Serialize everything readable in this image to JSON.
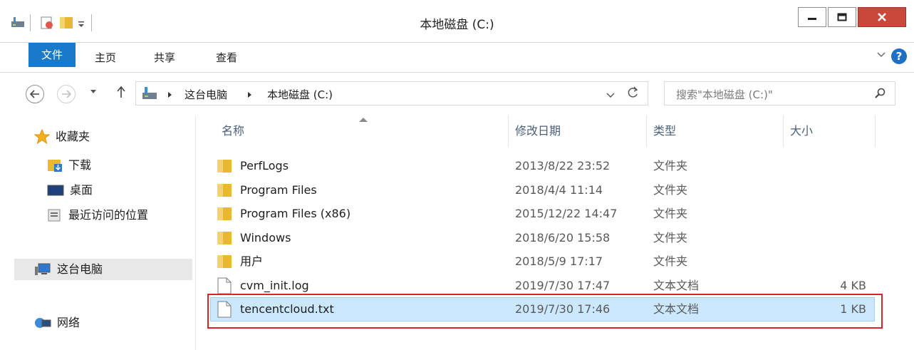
{
  "window": {
    "title": "本地磁盘 (C:)"
  },
  "ribbon": {
    "tabs": [
      {
        "label": "文件"
      },
      {
        "label": "主页"
      },
      {
        "label": "共享"
      },
      {
        "label": "查看"
      }
    ],
    "help_label": "?"
  },
  "address": {
    "breadcrumb": [
      "这台电脑",
      "本地磁盘 (C:)"
    ],
    "search_placeholder": "搜索\"本地磁盘 (C:)\""
  },
  "nav": {
    "favorites": {
      "label": "收藏夹",
      "items": [
        "下载",
        "桌面",
        "最近访问的位置"
      ]
    },
    "this_pc": "这台电脑",
    "network": "网络"
  },
  "columns": {
    "name": "名称",
    "modified": "修改日期",
    "type": "类型",
    "size": "大小"
  },
  "files": [
    {
      "name": "PerfLogs",
      "modified": "2013/8/22 23:52",
      "type": "文件夹",
      "size": "",
      "kind": "folder"
    },
    {
      "name": "Program Files",
      "modified": "2018/4/4 11:14",
      "type": "文件夹",
      "size": "",
      "kind": "folder"
    },
    {
      "name": "Program Files (x86)",
      "modified": "2015/12/22 14:47",
      "type": "文件夹",
      "size": "",
      "kind": "folder"
    },
    {
      "name": "Windows",
      "modified": "2018/6/20 15:58",
      "type": "文件夹",
      "size": "",
      "kind": "folder"
    },
    {
      "name": "用户",
      "modified": "2018/5/9 17:17",
      "type": "文件夹",
      "size": "",
      "kind": "folder"
    },
    {
      "name": "cvm_init.log",
      "modified": "2019/7/30 17:47",
      "type": "文本文档",
      "size": "4 KB",
      "kind": "file"
    },
    {
      "name": "tencentcloud.txt",
      "modified": "2019/7/30 17:46",
      "type": "文本文档",
      "size": "1 KB",
      "kind": "file",
      "selected": true
    }
  ],
  "colors": {
    "accent": "#1979ca",
    "selection": "#cce8ff",
    "highlight_border": "#d9252a",
    "folder": "#e8b92f"
  }
}
